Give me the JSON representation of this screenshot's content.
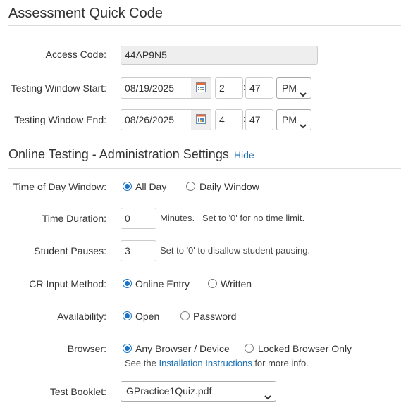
{
  "header": {
    "title": "Assessment Quick Code"
  },
  "access": {
    "label": "Access Code:",
    "value": "44AP9N5"
  },
  "window_start": {
    "label": "Testing Window Start:",
    "date": "08/19/2025",
    "hour": "2",
    "minute": "47",
    "ampm": "PM"
  },
  "window_end": {
    "label": "Testing Window End:",
    "date": "08/26/2025",
    "hour": "4",
    "minute": "47",
    "ampm": "PM"
  },
  "online": {
    "title": "Online Testing - Administration Settings",
    "hide_link": "Hide"
  },
  "time_of_day": {
    "label": "Time of Day Window:",
    "opt1": "All Day",
    "opt2": "Daily Window",
    "selected": "All Day"
  },
  "duration": {
    "label": "Time Duration:",
    "value": "0",
    "unit": "Minutes.",
    "hint": "Set to '0' for no time limit."
  },
  "pauses": {
    "label": "Student Pauses:",
    "value": "3",
    "hint": "Set to '0' to disallow student pausing."
  },
  "cr_input": {
    "label": "CR Input Method:",
    "opt1": "Online Entry",
    "opt2": "Written",
    "selected": "Online Entry"
  },
  "availability": {
    "label": "Availability:",
    "opt1": "Open",
    "opt2": "Password",
    "selected": "Open"
  },
  "browser": {
    "label": "Browser:",
    "opt1": "Any Browser / Device",
    "opt2": "Locked Browser Only",
    "selected": "Any Browser / Device",
    "note_prefix": "See the",
    "note_link": "Installation Instructions",
    "note_suffix": "for more info."
  },
  "booklet": {
    "label": "Test Booklet:",
    "value": "GPractice1Quiz.pdf"
  },
  "colors": {
    "link": "#1a6fb3",
    "radio_accent": "#1a73c4",
    "readonly_bg": "#eeeeee"
  }
}
